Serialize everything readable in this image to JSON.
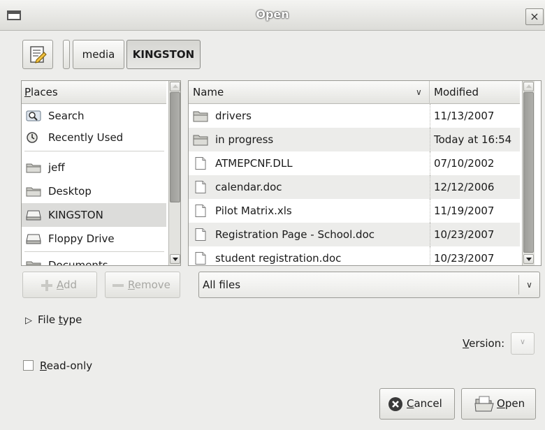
{
  "window": {
    "title": "Open",
    "close_glyph": "×"
  },
  "path_bar": {
    "segments": [
      "media",
      "KINGSTON"
    ],
    "edit_icon": "edit-location-icon"
  },
  "places": {
    "header_key": "P",
    "header_rest": "laces",
    "items": [
      {
        "label": "Search",
        "icon": "search-icon"
      },
      {
        "label": "Recently Used",
        "icon": "recent-icon"
      },
      {
        "label": "jeff",
        "icon": "folder-icon"
      },
      {
        "label": "Desktop",
        "icon": "folder-icon"
      },
      {
        "label": "KINGSTON",
        "icon": "drive-icon",
        "selected": true
      },
      {
        "label": "Floppy Drive",
        "icon": "drive-icon"
      },
      {
        "label": "Documents",
        "icon": "folder-icon"
      }
    ]
  },
  "files": {
    "columns": {
      "name": "Name",
      "modified": "Modified"
    },
    "rows": [
      {
        "name": "drivers",
        "modified": "11/13/2007",
        "type": "folder"
      },
      {
        "name": "in progress",
        "modified": "Today at 16:54",
        "type": "folder"
      },
      {
        "name": "ATMEPCNF.DLL",
        "modified": "07/10/2002",
        "type": "file"
      },
      {
        "name": "calendar.doc",
        "modified": "12/12/2006",
        "type": "file"
      },
      {
        "name": "Pilot Matrix.xls",
        "modified": "11/19/2007",
        "type": "file"
      },
      {
        "name": "Registration Page - School.doc",
        "modified": "10/23/2007",
        "type": "file"
      },
      {
        "name": "student registration.doc",
        "modified": "10/23/2007",
        "type": "file"
      }
    ]
  },
  "buttons": {
    "add_key": "A",
    "add_rest": "dd",
    "remove_key": "R",
    "remove_rest": "emove",
    "cancel_key": "C",
    "cancel_rest": "ancel",
    "open_key": "O",
    "open_rest": "pen"
  },
  "filter": {
    "selected": "All files"
  },
  "file_type": {
    "pre": "File ",
    "key": "t",
    "post": "ype"
  },
  "version": {
    "key": "V",
    "rest": "ersion:"
  },
  "read_only": {
    "key": "R",
    "rest": "ead-only",
    "checked": false
  }
}
